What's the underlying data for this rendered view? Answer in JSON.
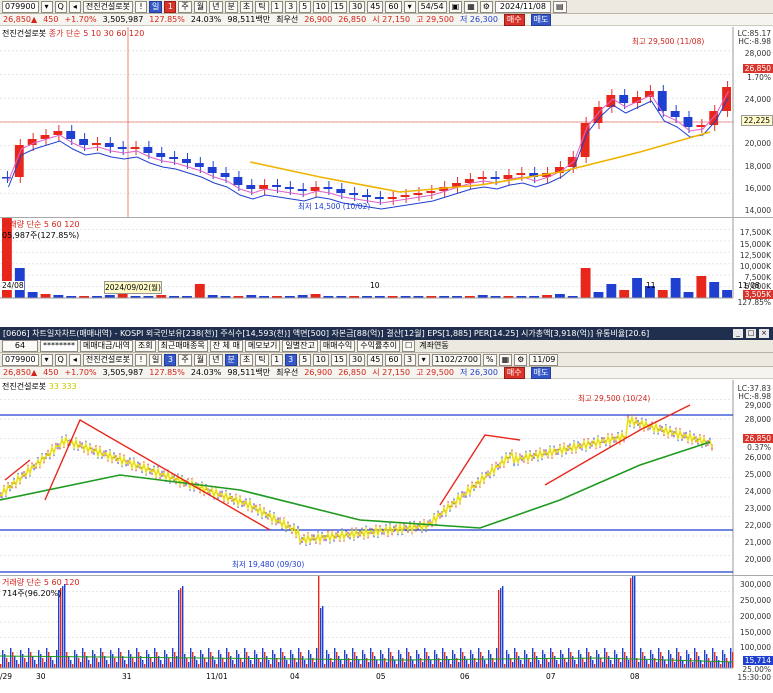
{
  "top_toolbar": {
    "code": "079900",
    "stock_name": "전진건설로봇",
    "mode_label": "일",
    "mode_value": "1",
    "periods": [
      "주",
      "월",
      "년",
      "분",
      "초",
      "틱"
    ],
    "intervals": [
      "1",
      "3",
      "5",
      "10",
      "15",
      "30",
      "45",
      "60"
    ],
    "count": "54/54",
    "date": "2024/11/08"
  },
  "top_quote": {
    "price": "26,850▲",
    "change": "450",
    "change_pct": "+1.70%",
    "volume": "3,505,987",
    "vol_ratio": "127.85%",
    "turnover": "24.03%",
    "amount": "98,511백만",
    "prev_label": "최우선",
    "bid": "26,900",
    "ask": "26,850",
    "open": "시 27,150",
    "high": "고 29,500",
    "low": "저 26,300",
    "buy_label": "매수",
    "sell_label": "매도"
  },
  "top_chart": {
    "legend_name": "전진건설로봇",
    "legend_ma": "종가 단순 5 10 30 60 120",
    "axis_labels": [
      "28,000",
      "26,000",
      "24,000",
      "22,000",
      "20,000",
      "18,000",
      "16,000",
      "14,000"
    ],
    "current_price": "26,850",
    "crosshair_price": "22,225",
    "lc": "LC:85.17",
    "hc": "HC:-8.98",
    "ratio": "1.70%",
    "high_note": "최고 29,500 (11/08)",
    "low_note": "최저 14,500 (10/02)",
    "date_labels": [
      "24/08",
      "2024/09/02(월)",
      "10",
      "11",
      "11/08"
    ]
  },
  "top_volume": {
    "legend": "거래량 단순 5 60 120",
    "value": "05,987주(127.85%)",
    "axis_labels": [
      "17,500K",
      "15,000K",
      "12,500K",
      "10,000K",
      "7,500K",
      "5,000K",
      "2,500K"
    ],
    "current": "3,505K",
    "ratio": "127.85%"
  },
  "info_bar": {
    "text": "[0606] 차트일자차트(매매내역) - KOSPI 외국인보유[238(천)] 주식수[14,593(천)] 액면[500] 자본금[88(억)] 결산[12월] EPS[1,885] PER[14.25] 시가총액[3,918(억)] 유통비율[20.6]"
  },
  "mid_toolbar": {
    "field": "64",
    "password": "********",
    "b1": "메매대금/내역",
    "b2": "조회",
    "b3": "최근매매종목",
    "b4": "잔 체 매",
    "b5": "메모보기",
    "b6": "일별잔고",
    "b7": "매매수익",
    "b8": "수익률추이",
    "b9": "계좌연동"
  },
  "bottom_toolbar": {
    "code": "079900",
    "stock_name": "전진건설로봇",
    "mode_value": "3",
    "periods": [
      "주",
      "월",
      "년",
      "분",
      "초",
      "틱"
    ],
    "intervals": [
      "1",
      "3",
      "5",
      "10",
      "15",
      "30",
      "45",
      "60"
    ],
    "count_prefix": "3",
    "count": "1102/2700",
    "date": "11/09"
  },
  "bottom_chart": {
    "legend_name": "전진건설로봇",
    "legend_ma": "33 333",
    "axis_labels": [
      "29,000",
      "28,000",
      "27,000",
      "26,000",
      "25,000",
      "24,000",
      "23,000",
      "22,000",
      "21,000",
      "20,000"
    ],
    "current_price": "26,850",
    "ratio": "0.37%",
    "lc": "LC:37.83",
    "hc": "HC:-8.98",
    "high_note": "최고 29,500 (10/24)",
    "low_note": "최저 19,480 (09/30)",
    "date_labels": [
      "/29",
      "30",
      "31",
      "11/01",
      "04",
      "05",
      "06",
      "07",
      "08"
    ]
  },
  "bottom_volume": {
    "legend": "거래량 단순 5 60 120",
    "value": "714주(96.20%)",
    "axis_labels": [
      "300,000",
      "250,000",
      "200,000",
      "150,000",
      "100,000",
      "50,000"
    ],
    "current": "15,714",
    "ratio": "25.00%",
    "time_label": "15:30:00"
  }
}
